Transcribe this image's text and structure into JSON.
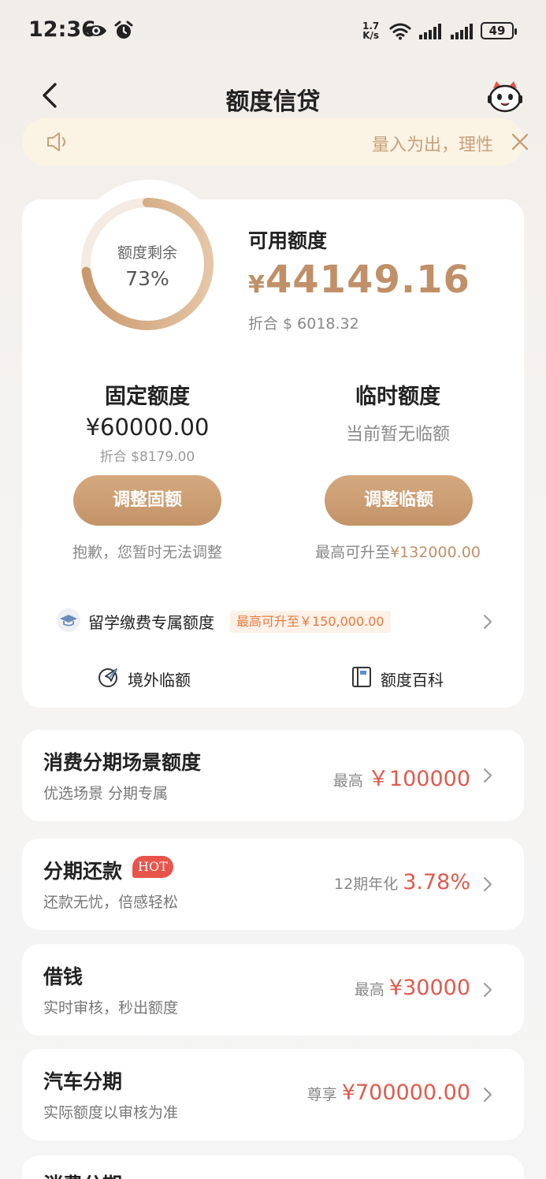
{
  "status_bar": {
    "time": "12:36",
    "net_speed_value": "1.7",
    "net_speed_unit": "K/s",
    "battery": "49"
  },
  "header": {
    "title": "额度信贷"
  },
  "notice": {
    "text": "量入为出，理性消费"
  },
  "credit": {
    "ring_label": "额度剩余",
    "ring_value": "73%",
    "remaining_fraction": 0.73,
    "available_label": "可用额度",
    "available_currency": "¥",
    "available_amount": "44149.16",
    "available_usd": "折合 $ 6018.32",
    "fixed": {
      "title": "固定额度",
      "amount": "¥60000.00",
      "usd": "折合 $8179.00",
      "button": "调整固额",
      "note": "抱歉，您暂时无法调整"
    },
    "temp": {
      "title": "临时额度",
      "status": "当前暂无临额",
      "button": "调整临额",
      "note_prefix": "最高可升至",
      "note_value": "¥132000.00"
    },
    "study": {
      "label": "留学缴费专属额度",
      "badge": "最高可升至￥150,000.00"
    },
    "tools": {
      "overseas": "境外临额",
      "wiki": "额度百科"
    }
  },
  "products": [
    {
      "title": "消费分期场景额度",
      "subtitle": "优选场景 分期专属",
      "prefix": "最高",
      "value": "￥100000"
    },
    {
      "title": "分期还款",
      "badge": "HOT",
      "subtitle": "还款无忧，倍感轻松",
      "prefix": "12期年化",
      "value": "3.78%"
    },
    {
      "title": "借钱",
      "subtitle": "实时审核，秒出额度",
      "prefix": "最高",
      "value": "¥30000"
    },
    {
      "title": "汽车分期",
      "subtitle": "实际额度以审核为准",
      "prefix": "尊享",
      "value": "¥700000.00"
    },
    {
      "title": "消费分期"
    }
  ],
  "colors": {
    "accent_gold": "#c09069",
    "button_gold": "#c9996d",
    "highlight_red": "#e05a4e",
    "hot_badge": "#e9544a"
  }
}
